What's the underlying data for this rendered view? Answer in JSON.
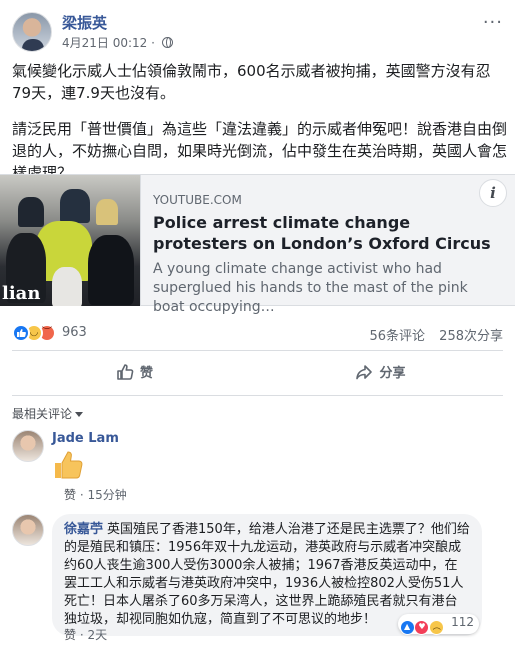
{
  "post": {
    "author": "梁振英",
    "timestamp": "4月21日 00:12",
    "dot": "·",
    "more_label": "···",
    "paragraphs": [
      "氣候變化示威人士佔領倫敦鬧市，600名示威者被拘捕，英國警方沒有忍79天，連7.9天也沒有。",
      "請泛民用「普世價值」為這些「違法違義」的示威者伸冤吧！說香港自由倒退的人，不妨撫心自問，如果時光倒流，佔中發生在英治時期，英國人會怎樣處理？"
    ]
  },
  "link_card": {
    "domain": "YOUTUBE.COM",
    "title": "Police arrest climate change protesters on London’s Oxford Circus",
    "description": "A young climate change activist who had superglued his hands to the mast of the pink boat occupying…",
    "thumbnail_watermark": "lian",
    "info_label": "i"
  },
  "reactions": {
    "icons": [
      "like-icon",
      "haha-icon",
      "angry-icon"
    ],
    "count": "963",
    "comments": "56条评论",
    "shares": "258次分享"
  },
  "actions": {
    "like_label": "赞",
    "share_label": "分享"
  },
  "comments_section": {
    "sort_label": "最相关评论",
    "comments": [
      {
        "name": "Jade Lam",
        "sticker": "thumbs-up-sticker",
        "like_label": "赞",
        "time": "15分钟"
      },
      {
        "name": "徐嘉苧",
        "text": "英国殖民了香港150年，给港人治港了还是民主选票了？他们给的是殖民和镇压：1956年双十九龙运动，港英政府与示威者冲突酿成约60人丧生逾300人受伤3000余人被捕；1967香港反英运动中，在罢工工人和示威者与港英政府冲突中，1936人被检控802人受伤51人死亡！日本人屠杀了60多万呆湾人，这世界上跪舔殖民者就只有港台独垃圾，却视同胞如仇寇，简直到了不可思议的地步！",
        "like_label": "赞",
        "time": "2天",
        "reaction_count": "112"
      }
    ]
  },
  "colors": {
    "link_blue": "#385898",
    "like_blue": "#1877f2",
    "muted": "#606770",
    "divider": "#dadde1"
  }
}
